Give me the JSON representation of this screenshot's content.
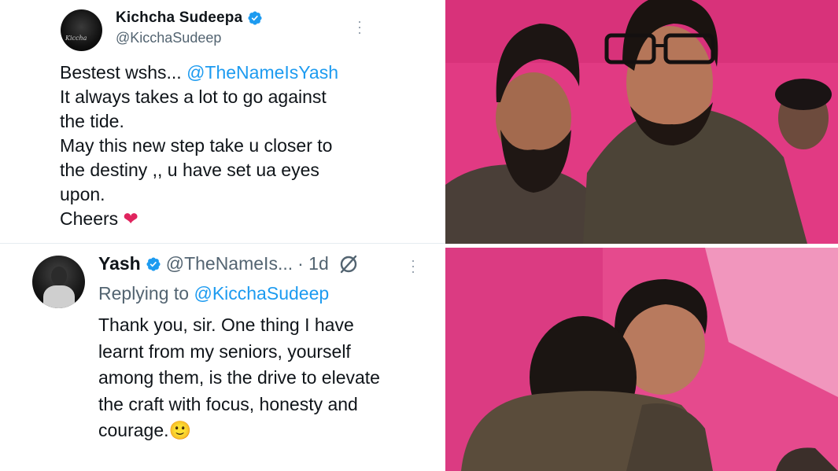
{
  "tweet1": {
    "name": "Kichcha Sudeepa",
    "handle": "@KicchaSudeep",
    "avatar_signature": "Kiccha",
    "lines": [
      {
        "text": "Bestest wshs... ",
        "mention": "@TheNameIsYash"
      },
      {
        "text": "It always takes a lot to go against"
      },
      {
        "text": "the tide."
      },
      {
        "text": "May this new step take u closer to"
      },
      {
        "text": "the destiny ,, u have set ua eyes"
      },
      {
        "text": "upon."
      },
      {
        "text": "Cheers ",
        "emoji": "❤"
      }
    ]
  },
  "tweet2": {
    "name": "Yash",
    "handle": "@TheNameIs...",
    "time": "· 1d",
    "replying_label": "Replying to",
    "replying_to": "@KicchaSudeep",
    "lines": [
      "Thank you, sir.  One thing I have",
      "learnt from my seniors, yourself",
      "among them, is the drive to elevate",
      "the craft with focus, honesty and",
      "courage.🙂"
    ]
  },
  "icons": {
    "verified": "verified-badge-icon",
    "more": "more-options-icon",
    "grok": "grok-icon"
  },
  "colors": {
    "accent": "#1d9bf0",
    "text": "#0f1419",
    "muted": "#536471",
    "heart": "#e0245e",
    "photo_bg": "#e4377f"
  }
}
